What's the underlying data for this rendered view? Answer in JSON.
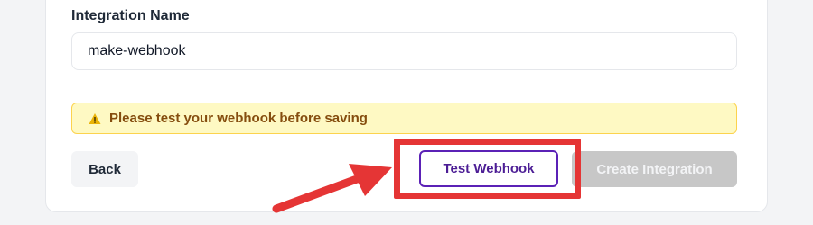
{
  "form": {
    "integration_name_label": "Integration Name",
    "integration_name_value": "make-webhook",
    "warning_text": "Please test your webhook before saving",
    "warning_icon": "warning-triangle-icon"
  },
  "actions": {
    "back_label": "Back",
    "test_webhook_label": "Test Webhook",
    "create_integration_label": "Create Integration",
    "create_integration_disabled": true
  },
  "annotation": {
    "highlight_color": "#e53535",
    "arrow_color": "#e53535",
    "highlight_target": "Test Webhook"
  }
}
